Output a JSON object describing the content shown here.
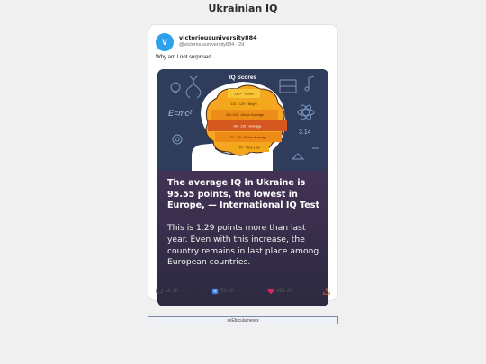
{
  "page": {
    "title": "Ukrainian IQ"
  },
  "post": {
    "avatar_letter": "V",
    "username": "victoriousuniversity884",
    "handle": "@victoriousuniversity884",
    "time": "2d",
    "text": "Why am I not surprised",
    "image": {
      "title": "IQ Scores",
      "bands": [
        {
          "label": "130+ · Gifted",
          "color": "#f7c637"
        },
        {
          "label": "115 - 129 · Bright",
          "color": "#f3a71b"
        },
        {
          "label": "110-114 · Above Average",
          "color": "#ec8e17"
        },
        {
          "label": "90 - 110 · Average",
          "color": "#d4581f"
        },
        {
          "label": "71 - 89 · Below Average",
          "color": "#ee8a16"
        },
        {
          "label": "70 · Very Low",
          "color": "#f3a71b"
        }
      ],
      "decor": [
        "E=mc²",
        "3.14",
        "DNA-icon",
        "lightbulb-icon",
        "atom-icon",
        "books-icon",
        "music-note-icon",
        "gear-icon"
      ],
      "headline": "The average IQ in Ukraine is 95.55 points, the lowest in Europe, — International IQ Test",
      "body": "This is 1.29 points more than last year. Even with this increase, the country remains in last place among European countries."
    },
    "actions": {
      "replies": "14.1K",
      "reposts": "53.6K",
      "likes": "461.2K"
    }
  },
  "footer_id": "xxEbiculamerex",
  "colors": {
    "avatar": "#2ca1ee",
    "heart": "#e0245e",
    "share": "#e2632a"
  }
}
